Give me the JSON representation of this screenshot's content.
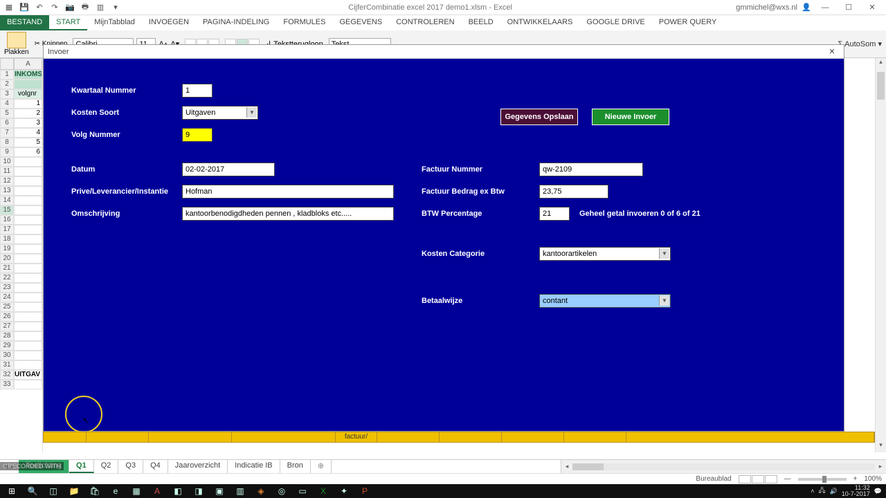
{
  "titlebar": {
    "doc_title": "CijferCombinatie excel 2017 demo1.xlsm - Excel",
    "user": "gmmichel@wxs.nl"
  },
  "ribbon": {
    "tabs": [
      "BESTAND",
      "START",
      "MijnTabblad",
      "INVOEGEN",
      "PAGINA-INDELING",
      "FORMULES",
      "GEGEVENS",
      "CONTROLEREN",
      "BEELD",
      "ONTWIKKELAARS",
      "GOOGLE DRIVE",
      "POWER QUERY"
    ],
    "active_tab_index": 1,
    "clipboard": {
      "paste": "Plakken",
      "cut": "Knippen"
    },
    "font": {
      "name": "Calibri",
      "size": "11"
    },
    "wrap": "Tekstterugloop",
    "number_format": "Tekst",
    "autosum": "AutoSom"
  },
  "sheet": {
    "col": "A",
    "inkom": "INKOMS",
    "volgnr": "volgnr",
    "row_values": [
      "1",
      "2",
      "3",
      "4",
      "5",
      "6"
    ],
    "uitgav": "UITGAV",
    "selected_row": 15,
    "yellow_row_label": "factuur/"
  },
  "modal": {
    "title": "Invoer",
    "labels": {
      "kwartaal": "Kwartaal Nummer",
      "kosten_soort": "Kosten Soort",
      "volg": "Volg Nummer",
      "datum": "Datum",
      "prive": "Prive/Leverancier/Instantie",
      "omschrijving": "Omschrijving",
      "factuur_nr": "Factuur Nummer",
      "factuur_bedrag": "Factuur Bedrag ex Btw",
      "btw": "BTW Percentage",
      "categorie": "Kosten Categorie",
      "betaalwijze": "Betaalwijze"
    },
    "values": {
      "kwartaal": "1",
      "kosten_soort": "Uitgaven",
      "volg": "9",
      "datum": "02-02-2017",
      "prive": "Hofman",
      "omschrijving": "kantoorbenodigdheden pennen , kladbloks etc.....",
      "factuur_nr": "qw-2109",
      "factuur_bedrag": "23,75",
      "btw": "21",
      "categorie": "kantoorartikelen",
      "betaalwijze": "contant"
    },
    "btw_hint": "Geheel getal invoeren 0 of 6 of 21",
    "btn_save": "Gegevens Opslaan",
    "btn_new": "Nieuwe Invoer"
  },
  "sheet_tabs": [
    "Toelichting",
    "Q1",
    "Q2",
    "Q3",
    "Q4",
    "Jaaroverzicht",
    "Indicatie IB",
    "Bron"
  ],
  "active_sheet_index": 1,
  "statusbar": {
    "recorded": "GRECORDED WITH",
    "brand1": "SCREENCAST",
    "brand2": "MATIC",
    "buro": "Bureaublad",
    "zoom": "100%"
  },
  "tray": {
    "time": "11:32",
    "date": "10-7-2017"
  }
}
